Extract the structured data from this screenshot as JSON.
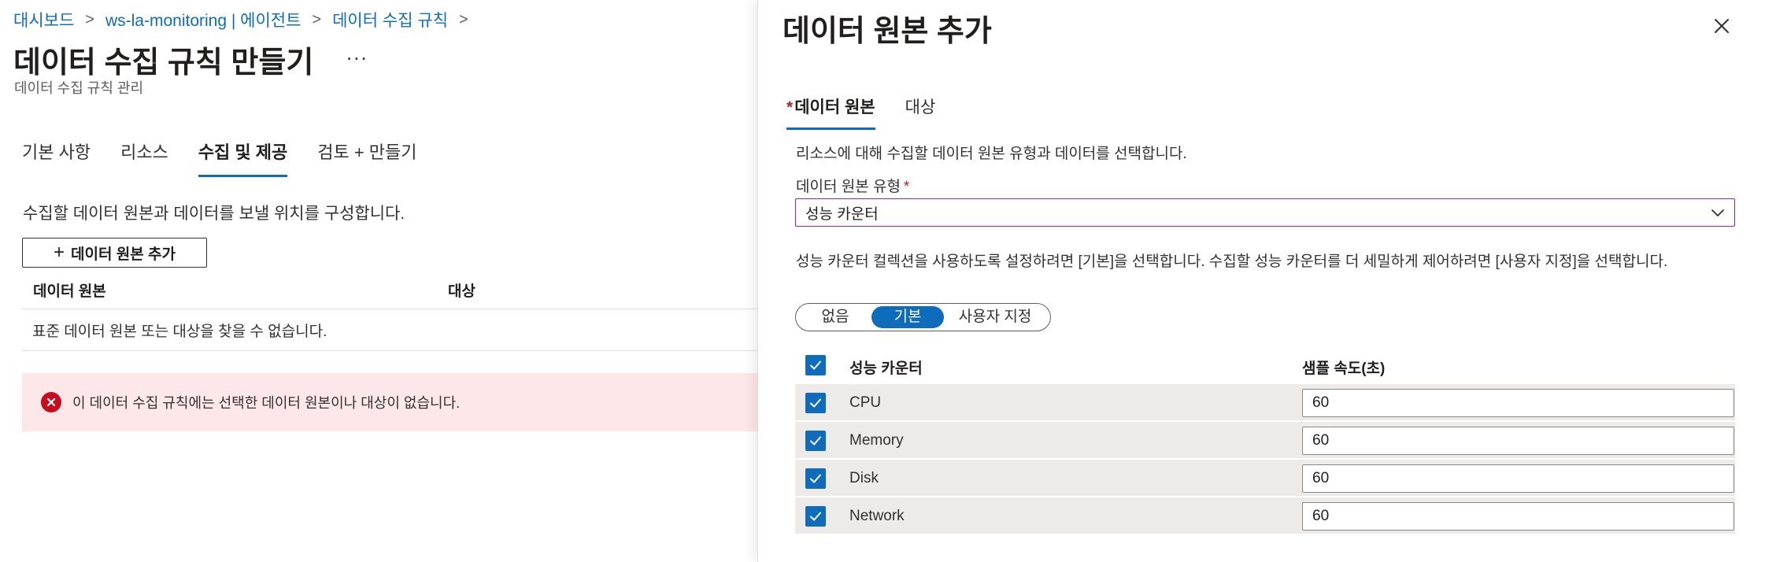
{
  "breadcrumb": {
    "items": [
      "대시보드",
      "ws-la-monitoring | 에이전트",
      "데이터 수집 규칙"
    ],
    "separator": ">"
  },
  "page": {
    "title": "데이터 수집 규칙 만들기",
    "more": "...",
    "subtitle": "데이터 수집 규칙 관리"
  },
  "tabs": [
    {
      "label": "기본 사항",
      "active": false
    },
    {
      "label": "리소스",
      "active": false
    },
    {
      "label": "수집 및 제공",
      "active": true
    },
    {
      "label": "검토 + 만들기",
      "active": false
    }
  ],
  "collect": {
    "description": "수집할 데이터 원본과 데이터를 보낼 위치를 구성합니다.",
    "add_button": "데이터 원본 추가",
    "table_headers": [
      "데이터 원본",
      "대상"
    ],
    "empty_text": "표준 데이터 원본 또는 대상을 찾을 수 없습니다.",
    "error_text": "이 데이터 수집 규칙에는 선택한 데이터 원본이나 대상이 없습니다."
  },
  "panel": {
    "title": "데이터 원본 추가",
    "tabs": [
      {
        "label": "데이터 원본",
        "required": true,
        "active": true
      },
      {
        "label": "대상",
        "required": false,
        "active": false
      }
    ],
    "required_mark": "*",
    "description": "리소스에 대해 수집할 데이터 원본 유형과 데이터를 선택합니다.",
    "source_type_label": "데이터 원본 유형",
    "source_type_value": "성능 카운터",
    "help_text": "성능 카운터 컬렉션을 사용하도록 설정하려면 [기본]을 선택합니다. 수집할 성능 카운터를 더 세밀하게 제어하려면 [사용자 지정]을 선택합니다.",
    "toggle": {
      "options": [
        "없음",
        "기본",
        "사용자 지정"
      ],
      "selected": "기본"
    },
    "counter_table": {
      "headers": [
        "성능 카운터",
        "샘플 속도(초)"
      ],
      "rows": [
        {
          "name": "CPU",
          "rate": "60",
          "checked": true
        },
        {
          "name": "Memory",
          "rate": "60",
          "checked": true
        },
        {
          "name": "Disk",
          "rate": "60",
          "checked": true
        },
        {
          "name": "Network",
          "rate": "60",
          "checked": true
        }
      ]
    }
  },
  "colors": {
    "accent": "#0f6cbd",
    "error_bg": "#fde7e9",
    "error_icon": "#c50f1f",
    "select_border": "#8a2d9b",
    "row_bg": "#edebe9"
  }
}
